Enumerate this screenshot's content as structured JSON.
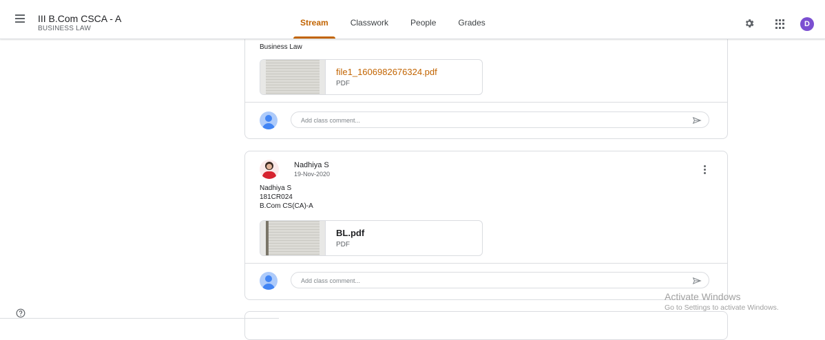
{
  "header": {
    "class_title": "III B.Com CSCA - A",
    "class_subtitle": "BUSINESS LAW",
    "tabs": [
      {
        "label": "Stream",
        "active": true
      },
      {
        "label": "Classwork",
        "active": false
      },
      {
        "label": "People",
        "active": false
      },
      {
        "label": "Grades",
        "active": false
      }
    ],
    "avatar_initial": "D",
    "icons": [
      "menu-icon",
      "gear-icon",
      "apps-icon"
    ]
  },
  "posts": [
    {
      "text": "Business Law",
      "attachment": {
        "name": "file1_1606982676324.pdf",
        "type": "PDF"
      },
      "comment_placeholder": "Add class comment..."
    },
    {
      "author": "Nadhiya S",
      "date": "19-Nov-2020",
      "lines": [
        "Nadhiya S",
        "181CR024",
        "B.Com CS(CA)-A"
      ],
      "attachment": {
        "name": "BL.pdf",
        "type": "PDF"
      },
      "comment_placeholder": "Add class comment..."
    }
  ],
  "watermark": {
    "title": "Activate Windows",
    "subtitle": "Go to Settings to activate Windows."
  },
  "colors": {
    "accent": "#c26401",
    "avatar": "#7b4fd1",
    "border": "#dadce0"
  }
}
